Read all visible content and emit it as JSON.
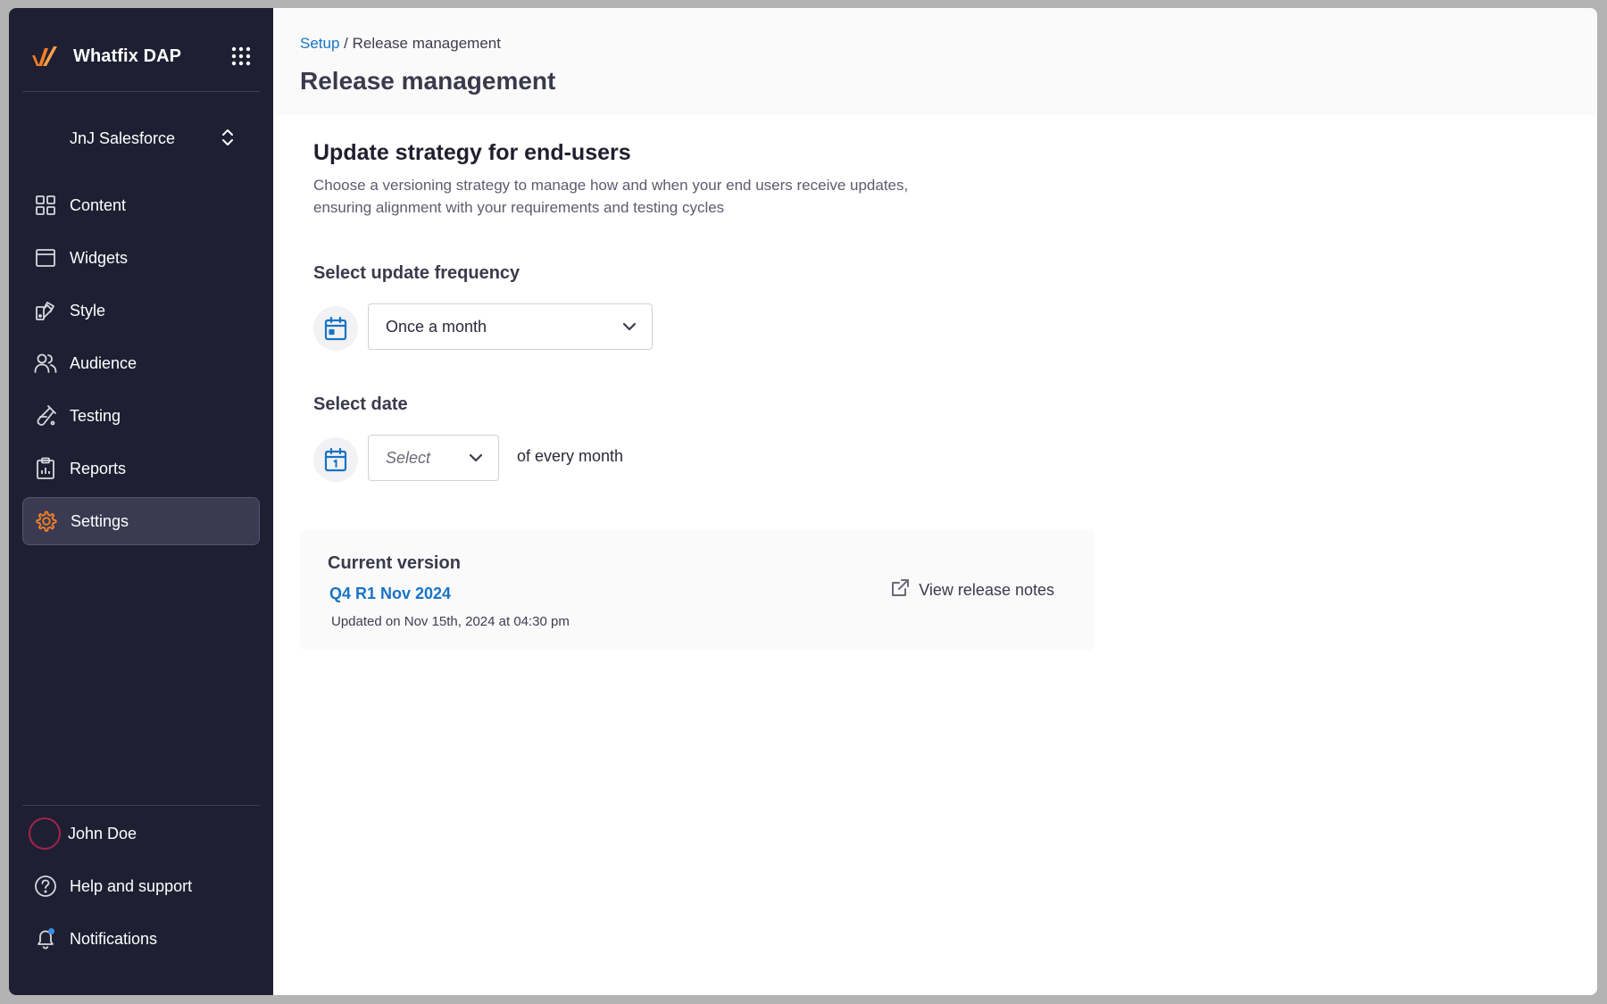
{
  "sidebar": {
    "brand": "Whatfix DAP",
    "account": "JnJ Salesforce",
    "nav": [
      {
        "label": "Content",
        "icon": "grid-icon"
      },
      {
        "label": "Widgets",
        "icon": "window-icon"
      },
      {
        "label": "Style",
        "icon": "palette-icon"
      },
      {
        "label": "Audience",
        "icon": "users-icon"
      },
      {
        "label": "Testing",
        "icon": "test-tube-icon"
      },
      {
        "label": "Reports",
        "icon": "clipboard-chart-icon"
      },
      {
        "label": "Settings",
        "icon": "gear-icon",
        "active": true
      }
    ],
    "user": "John Doe",
    "help": "Help and support",
    "notifications": "Notifications"
  },
  "header": {
    "breadcrumb_link": "Setup",
    "breadcrumb_sep": "/",
    "breadcrumb_current": "Release management",
    "title": "Release management"
  },
  "strategy": {
    "title": "Update strategy for end-users",
    "description": "Choose a versioning strategy to manage how and when your end users receive updates, ensuring alignment with your requirements and testing cycles",
    "frequency_label": "Select update frequency",
    "frequency_value": "Once a month",
    "date_label": "Select date",
    "date_placeholder": "Select",
    "date_suffix": "of every month"
  },
  "current": {
    "title": "Current version",
    "version": "Q4 R1 Nov 2024",
    "updated": "Updated on Nov 15th, 2024 at 04:30 pm",
    "release_notes": "View release notes"
  },
  "colors": {
    "sidebar_bg": "#1f1f33",
    "accent_orange": "#f07e26",
    "link_blue": "#1873c5",
    "notification_dot": "#3b8de0",
    "avatar_ring": "#a3244a"
  }
}
